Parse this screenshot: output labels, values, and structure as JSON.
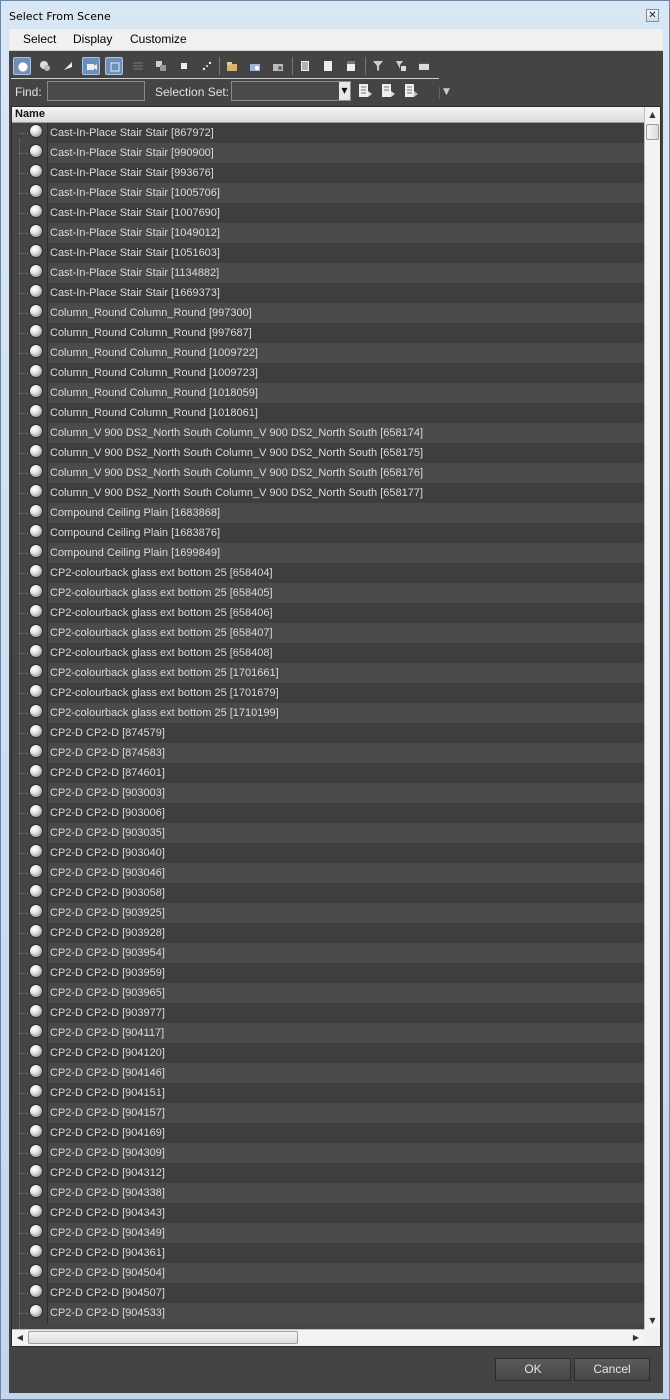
{
  "window": {
    "title": "Select From Scene",
    "close_glyph": "✕"
  },
  "menubar": {
    "items": [
      "Select",
      "Display",
      "Customize"
    ]
  },
  "toolbar": {
    "icons": [
      "display-geometry-icon",
      "display-shapes-icon",
      "display-lights-icon",
      "display-cameras-icon",
      "display-helpers-icon",
      "display-space-warps-icon",
      "display-groups-icon",
      "display-xrefs-icon",
      "display-bones-icon",
      "display-containers-icon",
      "display-frozen-icon",
      "display-hidden-icon",
      "display-all-icon",
      "display-none-icon",
      "display-invert-icon",
      "select-all-icon",
      "select-none-icon",
      "select-invert-icon"
    ],
    "find_label": "Find:",
    "find_value": "",
    "selection_set_label": "Selection Set:",
    "selection_set_value": ""
  },
  "list": {
    "header": "Name",
    "items": [
      "Cast-In-Place Stair Stair [867972]",
      "Cast-In-Place Stair Stair [990900]",
      "Cast-In-Place Stair Stair [993676]",
      "Cast-In-Place Stair Stair [1005706]",
      "Cast-In-Place Stair Stair [1007690]",
      "Cast-In-Place Stair Stair [1049012]",
      "Cast-In-Place Stair Stair [1051603]",
      "Cast-In-Place Stair Stair [1134882]",
      "Cast-In-Place Stair Stair [1669373]",
      "Column_Round Column_Round [997300]",
      "Column_Round Column_Round [997687]",
      "Column_Round Column_Round [1009722]",
      "Column_Round Column_Round [1009723]",
      "Column_Round Column_Round [1018059]",
      "Column_Round Column_Round [1018061]",
      "Column_V 900 DS2_North South Column_V 900 DS2_North South [658174]",
      "Column_V 900 DS2_North South Column_V 900 DS2_North South [658175]",
      "Column_V 900 DS2_North South Column_V 900 DS2_North South [658176]",
      "Column_V 900 DS2_North South Column_V 900 DS2_North South [658177]",
      "Compound Ceiling Plain [1683868]",
      "Compound Ceiling Plain [1683876]",
      "Compound Ceiling Plain [1699849]",
      "CP2-colourback glass ext bottom 25 [658404]",
      "CP2-colourback glass ext bottom 25 [658405]",
      "CP2-colourback glass ext bottom 25 [658406]",
      "CP2-colourback glass ext bottom 25 [658407]",
      "CP2-colourback glass ext bottom 25 [658408]",
      "CP2-colourback glass ext bottom 25 [1701661]",
      "CP2-colourback glass ext bottom 25 [1701679]",
      "CP2-colourback glass ext bottom 25 [1710199]",
      "CP2-D CP2-D [874579]",
      "CP2-D CP2-D [874583]",
      "CP2-D CP2-D [874601]",
      "CP2-D CP2-D [903003]",
      "CP2-D CP2-D [903006]",
      "CP2-D CP2-D [903035]",
      "CP2-D CP2-D [903040]",
      "CP2-D CP2-D [903046]",
      "CP2-D CP2-D [903058]",
      "CP2-D CP2-D [903925]",
      "CP2-D CP2-D [903928]",
      "CP2-D CP2-D [903954]",
      "CP2-D CP2-D [903959]",
      "CP2-D CP2-D [903965]",
      "CP2-D CP2-D [903977]",
      "CP2-D CP2-D [904117]",
      "CP2-D CP2-D [904120]",
      "CP2-D CP2-D [904146]",
      "CP2-D CP2-D [904151]",
      "CP2-D CP2-D [904157]",
      "CP2-D CP2-D [904169]",
      "CP2-D CP2-D [904309]",
      "CP2-D CP2-D [904312]",
      "CP2-D CP2-D [904338]",
      "CP2-D CP2-D [904343]",
      "CP2-D CP2-D [904349]",
      "CP2-D CP2-D [904361]",
      "CP2-D CP2-D [904504]",
      "CP2-D CP2-D [904507]",
      "CP2-D CP2-D [904533]"
    ]
  },
  "buttons": {
    "ok": "OK",
    "cancel": "Cancel"
  },
  "colors": {
    "panel": "#444444",
    "row_even": "#3e3e3e",
    "row_odd": "#4a4a4a",
    "text": "#dcdcdc",
    "active_icon": "#6c8eb8"
  }
}
